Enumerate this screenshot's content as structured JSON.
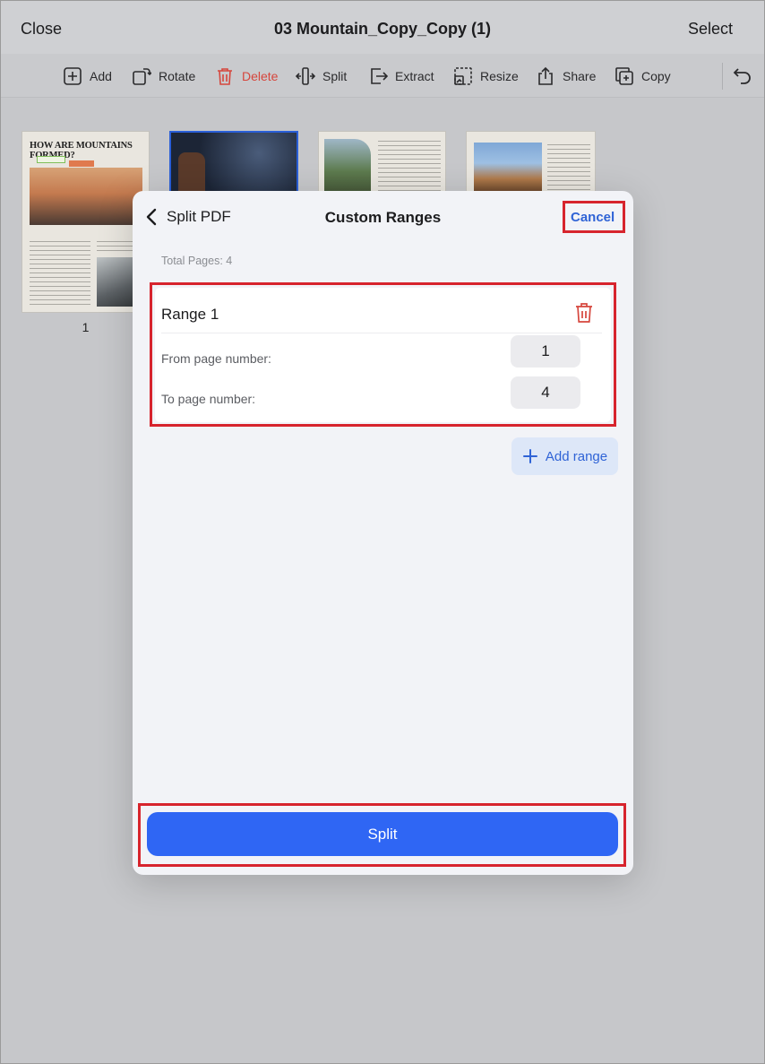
{
  "header": {
    "close_label": "Close",
    "document_title": "03 Mountain_Copy_Copy (1)",
    "select_label": "Select"
  },
  "toolbar": {
    "items": [
      {
        "label": "Add",
        "icon": "add-page-icon"
      },
      {
        "label": "Rotate",
        "icon": "rotate-icon"
      },
      {
        "label": "Delete",
        "icon": "trash-icon",
        "color": "#d6463d"
      },
      {
        "label": "Split",
        "icon": "split-icon"
      },
      {
        "label": "Extract",
        "icon": "extract-icon"
      },
      {
        "label": "Resize",
        "icon": "resize-icon"
      },
      {
        "label": "Share",
        "icon": "share-icon"
      },
      {
        "label": "Copy",
        "icon": "copy-icon"
      }
    ],
    "undo_icon": "undo-icon"
  },
  "pages": {
    "thumbnail_1": {
      "title": "HOW ARE MOUNTAINS FORMED?",
      "page_number": "1"
    }
  },
  "modal": {
    "back_label": "Split PDF",
    "title": "Custom Ranges",
    "cancel_label": "Cancel",
    "total_pages": "Total Pages: 4",
    "ranges": [
      {
        "title": "Range 1",
        "from_label": "From page number:",
        "from_value": "1",
        "to_label": "To page number:",
        "to_value": "4"
      }
    ],
    "add_range_label": "Add range",
    "split_label": "Split"
  },
  "colors": {
    "accent": "#2f63d6",
    "split_button": "#2f66f4",
    "danger": "#d6463d",
    "highlight": "#d7242d"
  }
}
